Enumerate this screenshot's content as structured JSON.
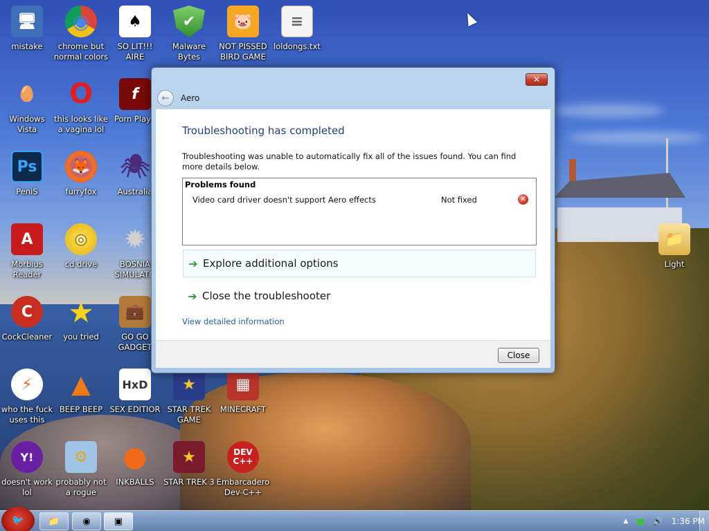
{
  "desktop": {
    "icons": [
      {
        "label": "mistake",
        "glyph": "🖥"
      },
      {
        "label": "chrome but normal colors",
        "glyph": "◉"
      },
      {
        "label": "SO LIT!!! AIRE",
        "glyph": "♠"
      },
      {
        "label": "Malware Bytes",
        "glyph": "✔"
      },
      {
        "label": "NOT PISSED BIRD GAME",
        "glyph": "🐷"
      },
      {
        "label": "loldongs.txt",
        "glyph": "≡"
      },
      {
        "label": "Windows Vista",
        "glyph": "🥚"
      },
      {
        "label": "this looks like a vagina lol",
        "glyph": "O"
      },
      {
        "label": "Porn Playe",
        "glyph": "f"
      },
      {
        "label": "PeniS",
        "glyph": "Ps"
      },
      {
        "label": "furryfox",
        "glyph": "🦊"
      },
      {
        "label": "Australia",
        "glyph": "🕷"
      },
      {
        "label": "Morbius Reader",
        "glyph": "A"
      },
      {
        "label": "cd drive",
        "glyph": "◎"
      },
      {
        "label": "BOSNIA SIMULATO",
        "glyph": "✹"
      },
      {
        "label": "CockCleaner",
        "glyph": "C"
      },
      {
        "label": "you tried",
        "glyph": "★"
      },
      {
        "label": "GO GO GADGET",
        "glyph": "💼"
      },
      {
        "label": "who the fuck uses this",
        "glyph": "⚡"
      },
      {
        "label": "BEEP BEEP",
        "glyph": "▲"
      },
      {
        "label": "SEX EDITIOR",
        "glyph": "HxD"
      },
      {
        "label": "STAR TREK GAME",
        "glyph": "★"
      },
      {
        "label": "MINECRAFT",
        "glyph": "▦"
      },
      {
        "label": "doesn't work lol",
        "glyph": "Y!"
      },
      {
        "label": "probably not a rogue",
        "glyph": "⚙"
      },
      {
        "label": "INKBALLS",
        "glyph": "●"
      },
      {
        "label": "STAR TREK 3",
        "glyph": "★"
      },
      {
        "label": "Embarcadero Dev-C++",
        "glyph": "DEV C++"
      },
      {
        "label": "Light",
        "glyph": "📁"
      }
    ]
  },
  "dialog": {
    "close_glyph": "✕",
    "back_glyph": "←",
    "app_title": "Aero",
    "heading": "Troubleshooting has completed",
    "description": "Troubleshooting was unable to automatically fix all of the issues found. You can find more details below.",
    "problems": {
      "header": "Problems found",
      "rows": [
        {
          "name": "Video card driver doesn't support Aero effects",
          "status": "Not fixed",
          "status_glyph": "✕"
        }
      ]
    },
    "options": [
      {
        "arrow": "➔",
        "label": "Explore additional options"
      },
      {
        "arrow": "➔",
        "label": "Close the troubleshooter"
      }
    ],
    "detail_link": "View detailed information",
    "close_button": "Close"
  },
  "taskbar": {
    "start_glyph": "🐦",
    "pinned": [
      {
        "name": "explorer",
        "glyph": "📁"
      },
      {
        "name": "chrome",
        "glyph": "◉"
      },
      {
        "name": "troubleshooter",
        "glyph": "▣"
      }
    ],
    "tray": {
      "show_hidden_glyph": "▲",
      "network_glyph": "■",
      "volume_glyph": "🔊",
      "time": "1:36 PM"
    }
  },
  "colors": {
    "heading_blue": "#1e3f8c",
    "link_blue": "#1f5fb0",
    "arrow_green": "#2e9b34",
    "close_red": "#c54633"
  }
}
